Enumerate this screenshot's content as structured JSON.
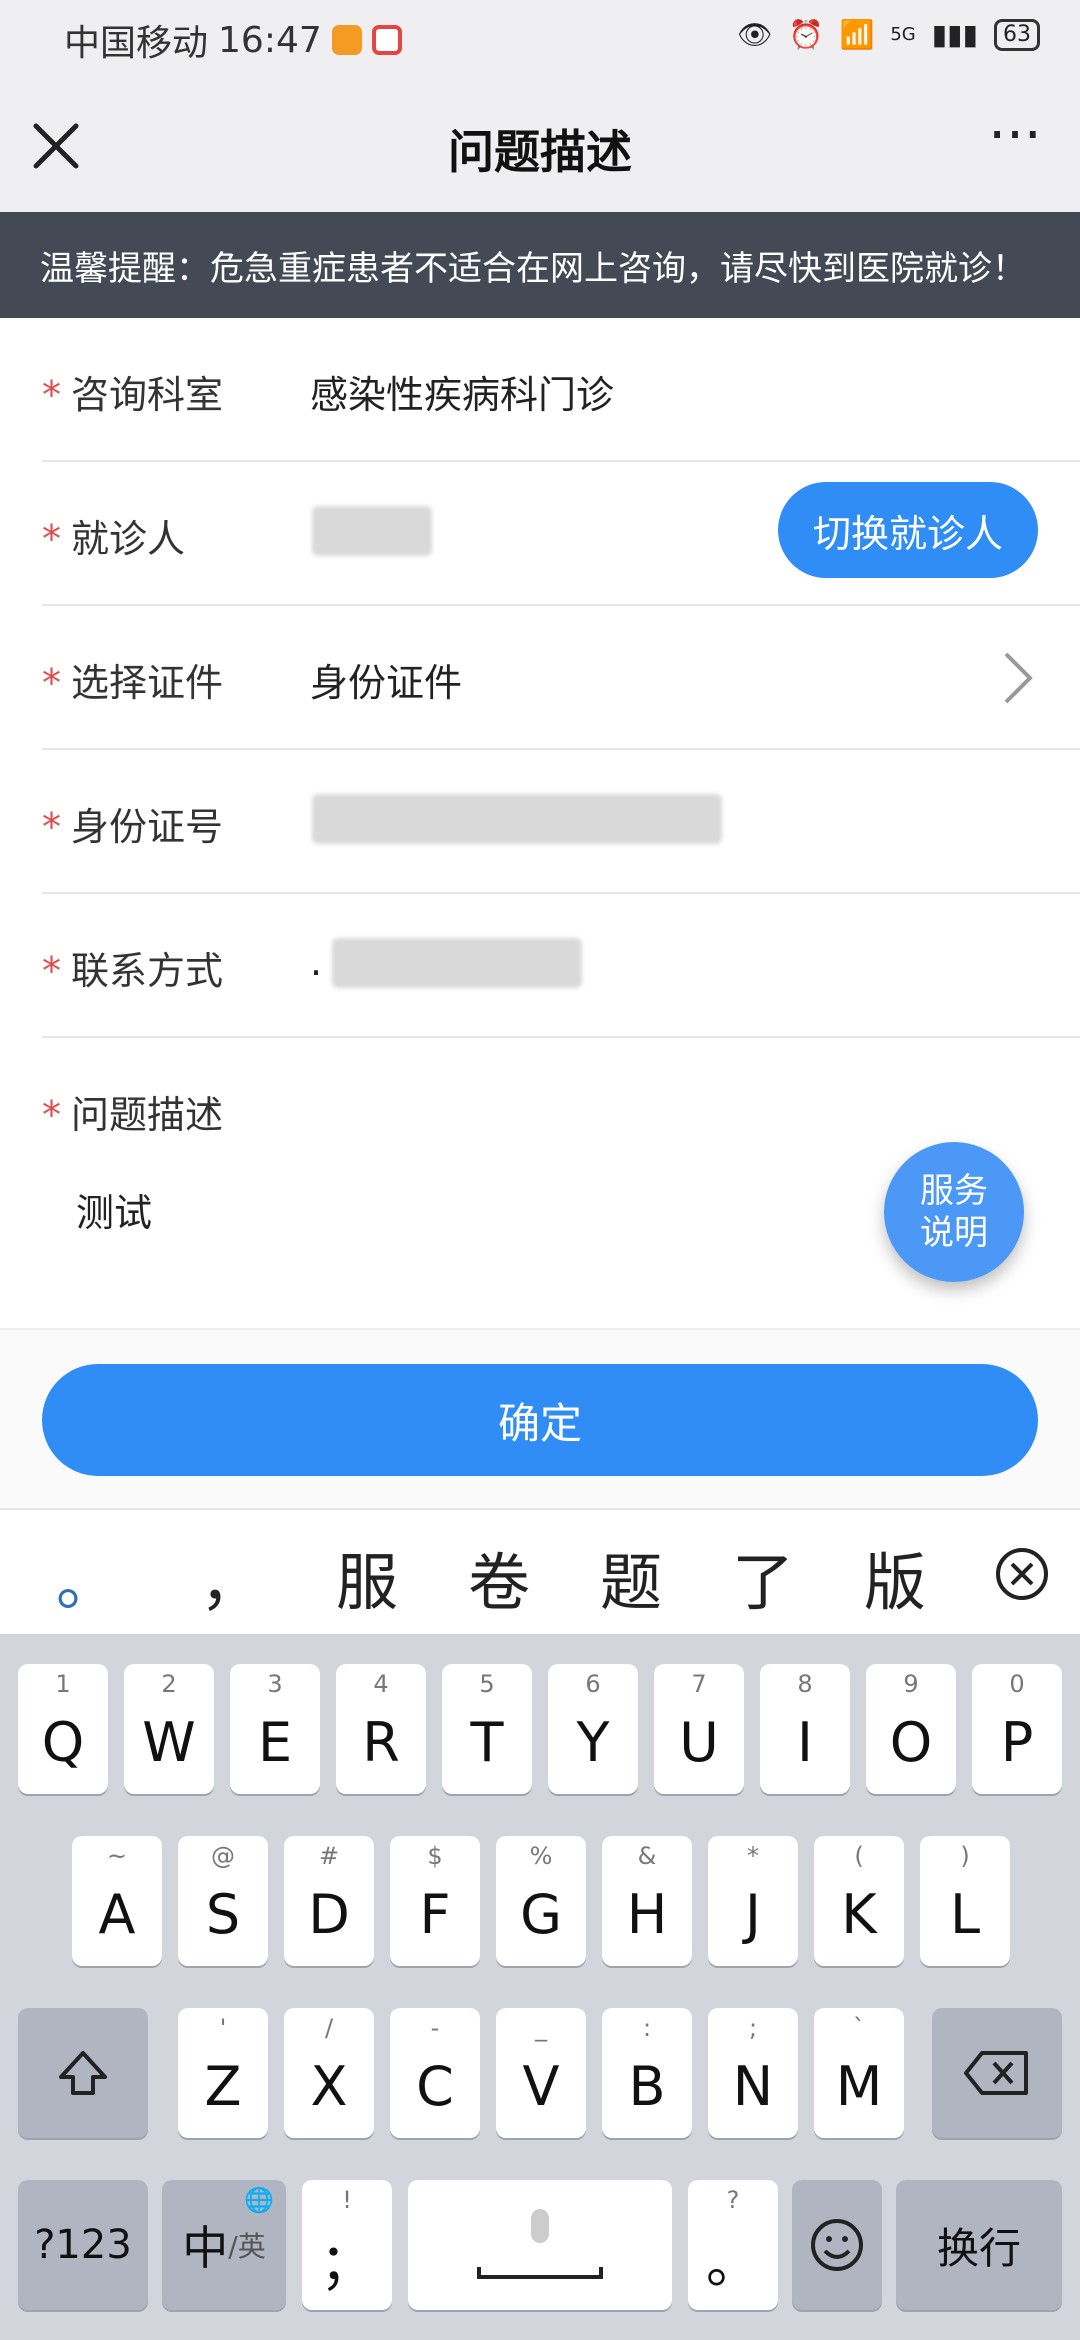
{
  "status_bar": {
    "carrier": "中国移动",
    "time": "16:47",
    "net": "5G",
    "battery": "63"
  },
  "header": {
    "title": "问题描述"
  },
  "notice": {
    "text": "温馨提醒：危急重症患者不适合在网上咨询，请尽快到医院就诊！"
  },
  "form": {
    "dept": {
      "label": "咨询科室",
      "value": "感染性疾病科门诊"
    },
    "patient": {
      "label": "就诊人",
      "switch_label": "切换就诊人"
    },
    "cert": {
      "label": "选择证件",
      "value": "身份证件"
    },
    "id": {
      "label": "身份证号"
    },
    "contact": {
      "label": "联系方式",
      "value_prefix": "."
    },
    "desc": {
      "label": "问题描述",
      "value": "测试"
    }
  },
  "service_button": {
    "line1": "服务",
    "line2": "说明"
  },
  "confirm_label": "确定",
  "candidates": [
    "。",
    "，",
    "服",
    "卷",
    "题",
    "了",
    "版"
  ],
  "keyboard": {
    "row1": [
      {
        "hint": "1",
        "key": "Q"
      },
      {
        "hint": "2",
        "key": "W"
      },
      {
        "hint": "3",
        "key": "E"
      },
      {
        "hint": "4",
        "key": "R"
      },
      {
        "hint": "5",
        "key": "T"
      },
      {
        "hint": "6",
        "key": "Y"
      },
      {
        "hint": "7",
        "key": "U"
      },
      {
        "hint": "8",
        "key": "I"
      },
      {
        "hint": "9",
        "key": "O"
      },
      {
        "hint": "0",
        "key": "P"
      }
    ],
    "row2": [
      {
        "hint": "~",
        "key": "A"
      },
      {
        "hint": "@",
        "key": "S"
      },
      {
        "hint": "#",
        "key": "D"
      },
      {
        "hint": "$",
        "key": "F"
      },
      {
        "hint": "%",
        "key": "G"
      },
      {
        "hint": "&",
        "key": "H"
      },
      {
        "hint": "*",
        "key": "J"
      },
      {
        "hint": "(",
        "key": "K"
      },
      {
        "hint": ")",
        "key": "L"
      }
    ],
    "row3": [
      {
        "hint": "'",
        "key": "Z"
      },
      {
        "hint": "/",
        "key": "X"
      },
      {
        "hint": "-",
        "key": "C"
      },
      {
        "hint": "_",
        "key": "V"
      },
      {
        "hint": ":",
        "key": "B"
      },
      {
        "hint": ";",
        "key": "N"
      },
      {
        "hint": "`",
        "key": "M"
      }
    ],
    "bottom": {
      "num": "?123",
      "lang_main": "中",
      "lang_sub": "/英",
      "punct_top": "!",
      "punct": "；",
      "q_top": "?",
      "q": "。",
      "enter": "换行"
    }
  }
}
